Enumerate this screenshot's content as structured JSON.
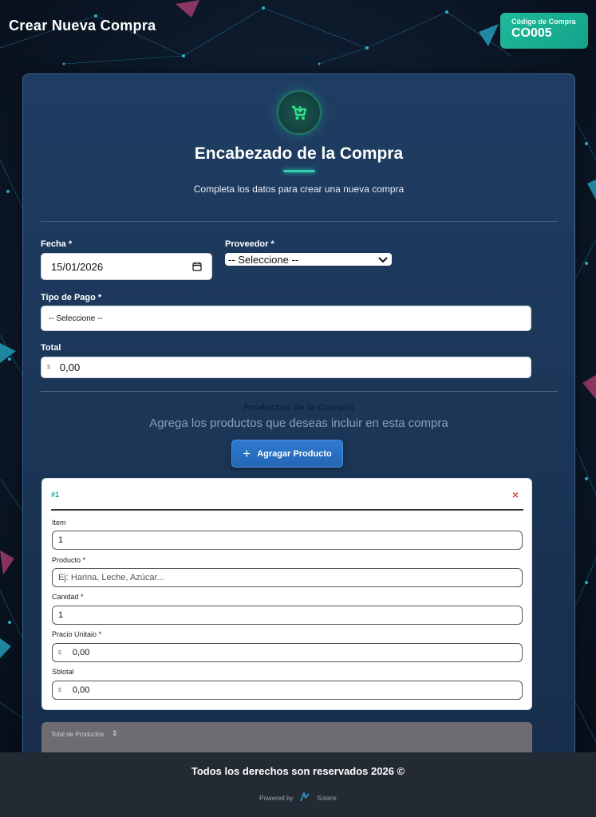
{
  "header": {
    "title": "Crear Nueva Compra"
  },
  "badge": {
    "label": "Código de Compra",
    "value": "CO005"
  },
  "card": {
    "icon": "shopping-cart-icon",
    "title": "Encabezado de la Compra",
    "subtitle": "Completa los datos para crear una nueva compra"
  },
  "form": {
    "fecha_label": "Fecha *",
    "fecha_value": "15/01/2026",
    "proveedor_label": "Proveedor *",
    "proveedor_value": "-- Seleccione --",
    "tipo_pago_label": "Tipo de Pago *",
    "tipo_pago_value": "-- Seleccione --",
    "total_label": "Total",
    "total_currency": "$",
    "total_value": "0,00"
  },
  "products": {
    "section_title": "Productos de la Compra",
    "section_subtitle": "Agrega los productos que deseas incluir en esta compra",
    "add_button": "Agragar Producto",
    "item": {
      "number": "#1",
      "close": "×",
      "item_label": "Item",
      "item_value": "1",
      "producto_label": "Producto *",
      "producto_placeholder": "Ej: Harina, Leche, Azúcar...",
      "cantidad_label": "Canidad *",
      "cantidad_value": "1",
      "precio_label": "Pracio Unitaio *",
      "precio_currency": "$",
      "precio_value": "0,00",
      "subtotal_label": "Sblotal",
      "subtotal_currency": "$",
      "subtotal_value": "0,00"
    },
    "summary_label": "Total de Productos"
  },
  "footer": {
    "copyright": "Todos los derechos son reservados 2026 ©",
    "powered_by": "Powered by",
    "brand": "Solarix"
  },
  "colors": {
    "accent": "#1fb99a",
    "primary_button": "#2f7ad0",
    "close": "#d9534f",
    "card_bg": "#1f3d63"
  }
}
